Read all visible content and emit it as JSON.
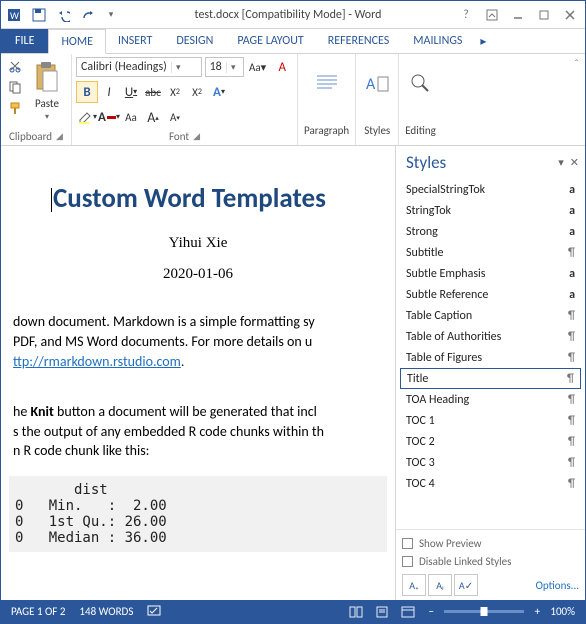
{
  "titlebar": {
    "title": "test.docx [Compatibility Mode] - Word"
  },
  "ribbon": {
    "tabs": {
      "file": "FILE",
      "home": "HOME",
      "insert": "INSERT",
      "design": "DESIGN",
      "pagelayout": "PAGE LAYOUT",
      "references": "REFERENCES",
      "mailings": "MAILINGS"
    },
    "clipboard": {
      "label": "Clipboard",
      "paste": "Paste"
    },
    "font": {
      "label": "Font",
      "name": "Calibri (Headings)",
      "size": "18",
      "bold": "B",
      "italic": "I",
      "underline": "U",
      "strike": "abc",
      "sub": "X",
      "sup": "X",
      "clear": "A"
    },
    "paragraph": {
      "label": "Paragraph"
    },
    "styles": {
      "label": "Styles"
    },
    "editing": {
      "label": "Editing"
    }
  },
  "document": {
    "title": "Custom Word Templates",
    "author": "Yihui Xie",
    "date": "2020-01-06",
    "p1a": "down document. Markdown is a simple formatting sy",
    "p1b": " PDF, and MS Word documents. For more details on u",
    "p1link": "ttp://rmarkdown.rstudio.com",
    "p2a": "he ",
    "p2knit": "Knit",
    "p2b": " button a document will be generated that incl",
    "p2c": "s the output of any embedded R code chunks within th",
    "p2d": "n R code chunk like this:",
    "code": "       dist\n0   Min.   :  2.00\n0   1st Qu.: 26.00\n0   Median : 36.00"
  },
  "styles_pane": {
    "title": "Styles",
    "items": [
      {
        "name": "SpecialStringTok",
        "mark": "a"
      },
      {
        "name": "StringTok",
        "mark": "a"
      },
      {
        "name": "Strong",
        "mark": "a"
      },
      {
        "name": "Subtitle",
        "mark": "¶"
      },
      {
        "name": "Subtle Emphasis",
        "mark": "a"
      },
      {
        "name": "Subtle Reference",
        "mark": "a"
      },
      {
        "name": "Table Caption",
        "mark": "¶"
      },
      {
        "name": "Table of Authorities",
        "mark": "¶"
      },
      {
        "name": "Table of Figures",
        "mark": "¶"
      },
      {
        "name": "Title",
        "mark": "¶"
      },
      {
        "name": "TOA Heading",
        "mark": "¶"
      },
      {
        "name": "TOC 1",
        "mark": "¶"
      },
      {
        "name": "TOC 2",
        "mark": "¶"
      },
      {
        "name": "TOC 3",
        "mark": "¶"
      },
      {
        "name": "TOC 4",
        "mark": "¶"
      }
    ],
    "selected_index": 9,
    "show_preview": "Show Preview",
    "disable_linked": "Disable Linked Styles",
    "options": "Options..."
  },
  "statusbar": {
    "page": "PAGE 1 OF 2",
    "words": "148 WORDS",
    "zoom": "100%",
    "minus": "−",
    "plus": "+"
  }
}
